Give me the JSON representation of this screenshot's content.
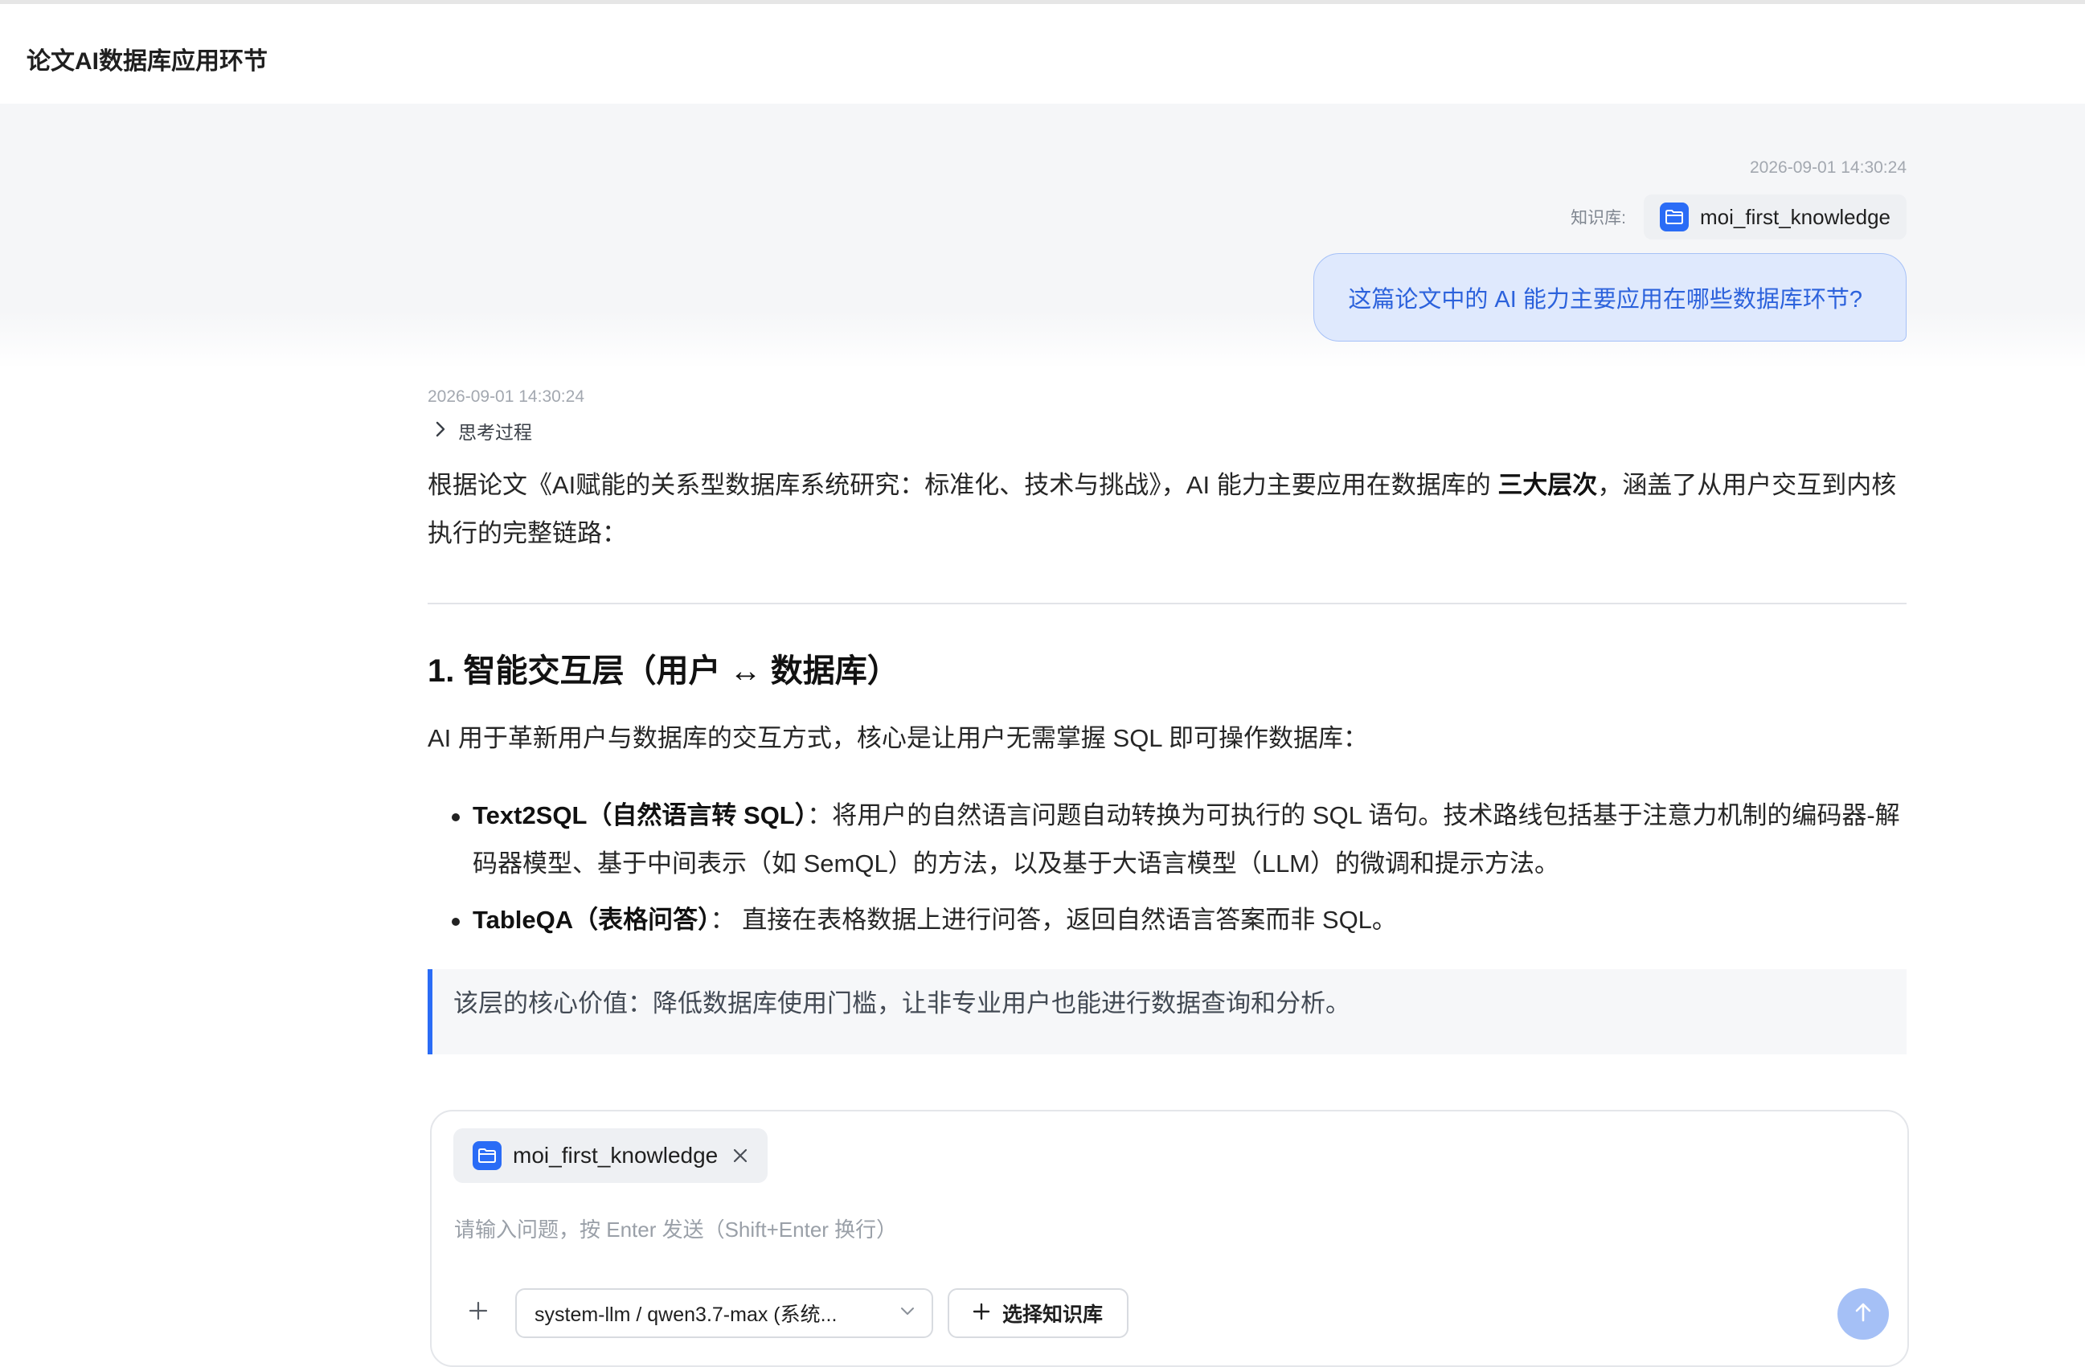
{
  "header": {
    "title": "论文AI数据库应用环节"
  },
  "user_message": {
    "timestamp": "2026-09-01 14:30:24",
    "kb_label": "知识库:",
    "kb_name": "moi_first_knowledge",
    "text": "这篇论文中的 AI 能力主要应用在哪些数据库环节?"
  },
  "ai_message": {
    "timestamp": "2026-09-01 14:30:24",
    "thinking_label": "思考过程",
    "intro_pre": "根据论文《AI赋能的关系型数据库系统研究：标准化、技术与挑战》，AI 能力主要应用在数据库的 ",
    "intro_bold": "三大层次",
    "intro_post": "，涵盖了从用户交互到内核执行的完整链路：",
    "section1": {
      "heading": "1. 智能交互层（用户 ↔ 数据库）",
      "desc": "AI 用于革新用户与数据库的交互方式，核心是让用户无需掌握 SQL 即可操作数据库：",
      "bullets": [
        {
          "bold": "Text2SQL（自然语言转 SQL）",
          "text": "：将用户的自然语言问题自动转换为可执行的 SQL 语句。技术路线包括基于注意力机制的编码器-解码器模型、基于中间表示（如 SemQL）的方法，以及基于大语言模型（LLM）的微调和提示方法。"
        },
        {
          "bold": "TableQA（表格问答）",
          "text": "： 直接在表格数据上进行问答，返回自然语言答案而非 SQL。"
        }
      ],
      "quote": "该层的核心价值：降低数据库使用门槛，让非专业用户也能进行数据查询和分析。"
    }
  },
  "composer": {
    "kb_chip": "moi_first_knowledge",
    "placeholder": "请输入问题，按 Enter 发送（Shift+Enter 换行）",
    "model_select": "system-llm / qwen3.7-max (系统...",
    "select_kb_label": "选择知识库"
  },
  "colors": {
    "accent": "#2a6cf6",
    "bubble_bg": "#dfe9fd",
    "send_disabled": "#a5c0f6"
  },
  "icons": [
    "folder-icon",
    "chevron-right-icon",
    "close-icon",
    "plus-icon",
    "chevron-down-icon",
    "arrow-up-icon"
  ]
}
